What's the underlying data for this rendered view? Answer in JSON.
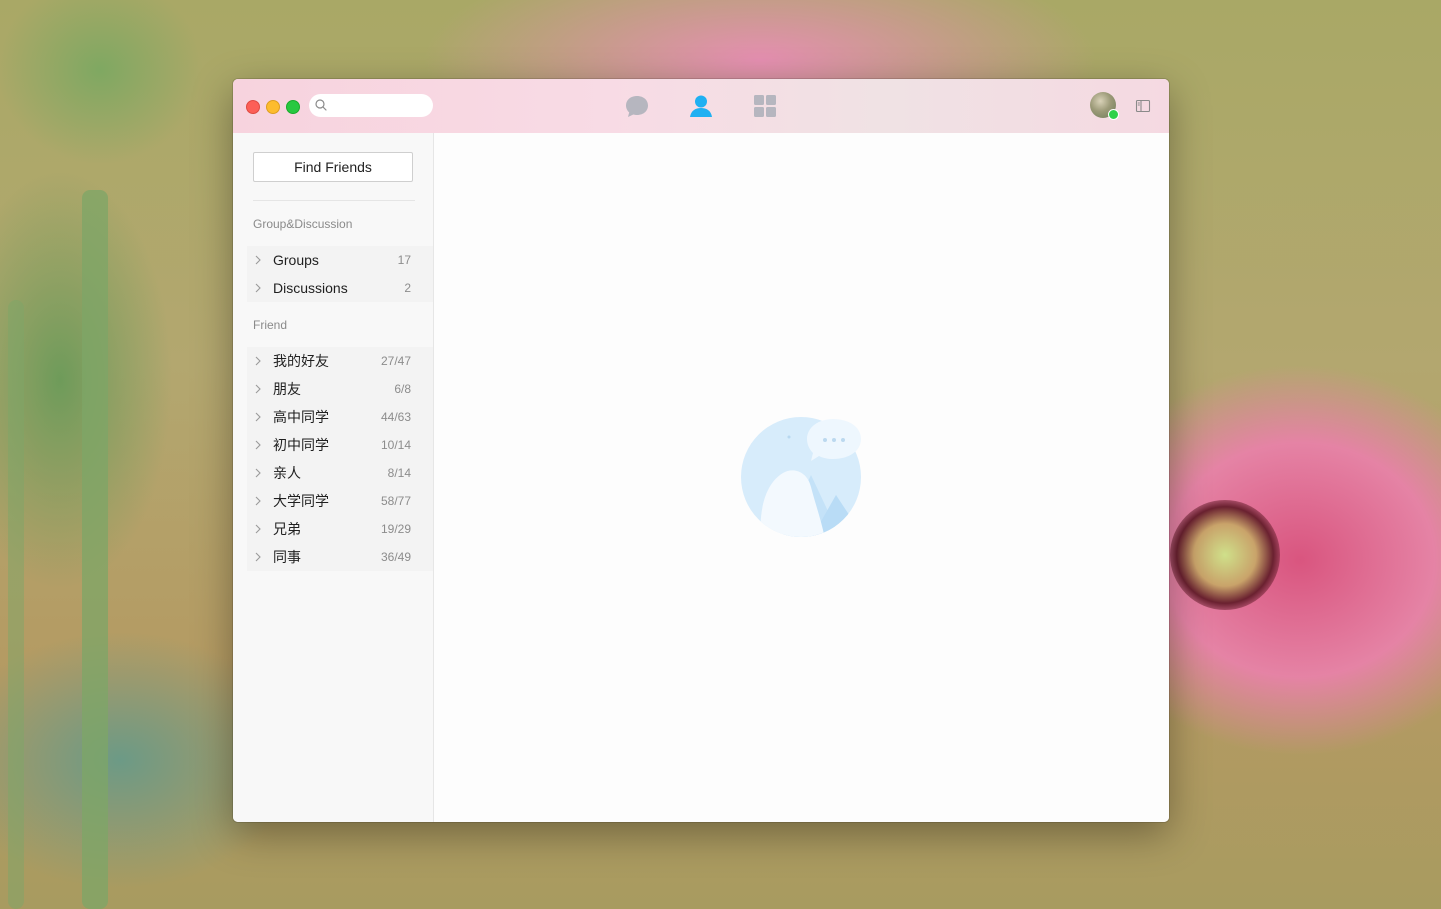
{
  "window": {
    "search": {
      "placeholder": "",
      "value": ""
    },
    "nav": [
      {
        "icon": "chat-bubble-icon",
        "active": false
      },
      {
        "icon": "contacts-person-icon",
        "active": true
      },
      {
        "icon": "apps-grid-icon",
        "active": false
      }
    ],
    "user": {
      "status": "online"
    }
  },
  "sidebar": {
    "find_friends_label": "Find Friends",
    "group_section_label": "Group&Discussion",
    "groups": [
      {
        "label": "Groups",
        "count": "17"
      },
      {
        "label": "Discussions",
        "count": "2"
      }
    ],
    "friend_section_label": "Friend",
    "friends": [
      {
        "label": "我的好友",
        "count": "27/47"
      },
      {
        "label": "朋友",
        "count": "6/8"
      },
      {
        "label": "高中同学",
        "count": "44/63"
      },
      {
        "label": "初中同学",
        "count": "10/14"
      },
      {
        "label": "亲人",
        "count": "8/14"
      },
      {
        "label": "大学同学",
        "count": "58/77"
      },
      {
        "label": "兄弟",
        "count": "19/29"
      },
      {
        "label": "同事",
        "count": "36/49"
      }
    ]
  },
  "colors": {
    "accent": "#1fb0f2",
    "inactive_icon": "#b8b8c2",
    "online": "#2fd14a"
  }
}
